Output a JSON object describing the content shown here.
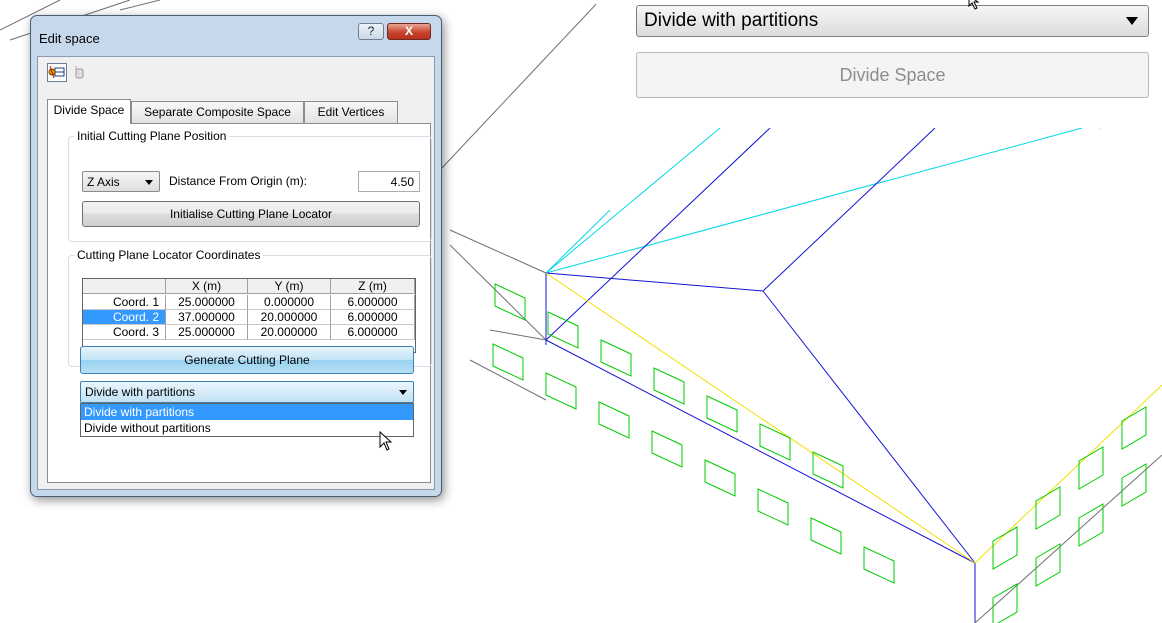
{
  "dialog": {
    "title": "Edit space",
    "help_label": "?",
    "close_label": "X",
    "tabs": [
      "Divide Space",
      "Separate Composite Space",
      "Edit Vertices"
    ],
    "active_tab": "Divide Space"
  },
  "initial_plane": {
    "group_title": "Initial Cutting Plane Position",
    "axis_value": "Z Axis",
    "distance_label": "Distance From Origin (m):",
    "distance_value": "4.50",
    "init_button": "Initialise Cutting Plane Locator"
  },
  "locator": {
    "group_title": "Cutting Plane Locator Coordinates",
    "columns": [
      "",
      "X (m)",
      "Y (m)",
      "Z (m)"
    ],
    "rows": [
      [
        "Coord. 1",
        "25.000000",
        "0.000000",
        "6.000000"
      ],
      [
        "Coord. 2",
        "37.000000",
        "20.000000",
        "6.000000"
      ],
      [
        "Coord. 3",
        "25.000000",
        "20.000000",
        "6.000000"
      ]
    ],
    "selected_row": "Coord. 2"
  },
  "generate_button": "Generate Cutting Plane",
  "divide_select": {
    "value": "Divide with partitions",
    "options": [
      "Divide with partitions",
      "Divide without partitions"
    ],
    "highlighted": "Divide with partitions"
  },
  "zoom_inset": {
    "select_value": "Divide with partitions",
    "button_label": "Divide Space"
  },
  "colors": {
    "dialog_frame": "#c6d9ec",
    "selection": "#3399ff",
    "wireframe_blue": "#0000cc",
    "wireframe_cyan": "#00d8e8",
    "wireframe_yellow": "#f0e000",
    "window_green": "#00cc00",
    "wireframe_grey": "#707070"
  },
  "icons": [
    "cut-plane-tool-icon",
    "vertex-tool-icon",
    "mouse-pointer-icon",
    "dropdown-arrow-icon"
  ]
}
